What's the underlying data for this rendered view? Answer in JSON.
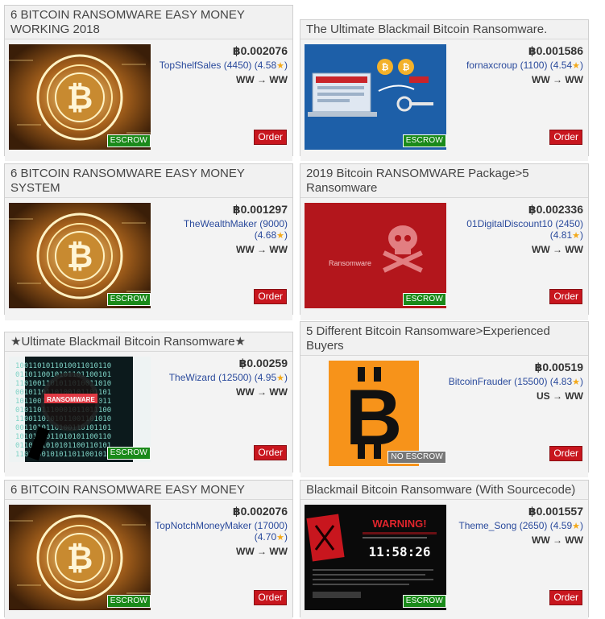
{
  "listings": [
    {
      "title": "6 BITCOIN RANSOMWARE EASY MONEY WORKING 2018",
      "price": "฿0.002076",
      "seller": "TopShelfSales (4450) (4.58",
      "star": "★",
      "seller_end": ")",
      "ship": "WW → WW",
      "badge": "ESCROW",
      "order": "Order",
      "image": "bitcoin-gold-coin"
    },
    {
      "title": "The Ultimate Blackmail Bitcoin Ransomware.",
      "price": "฿0.001586",
      "seller": "fornaxcroup (1100) (4.54",
      "star": "★",
      "seller_end": ")",
      "ship": "WW → WW",
      "badge": "ESCROW",
      "order": "Order",
      "image": "laptop-ransomware"
    },
    {
      "title": "6 BITCOIN RANSOMWARE EASY MONEY SYSTEM",
      "price": "฿0.001297",
      "seller": "TheWealthMaker (9000) (4.68",
      "star": "★",
      "seller_end": ")",
      "ship": "WW → WW",
      "badge": "ESCROW",
      "order": "Order",
      "image": "bitcoin-gold-coin"
    },
    {
      "title": "2019 Bitcoin RANSOMWARE Package>5 Ransomware",
      "price": "฿0.002336",
      "seller": "01DigitalDiscount10 (2450) (4.81",
      "star": "★",
      "seller_end": ")",
      "ship": "WW → WW",
      "badge": "ESCROW",
      "order": "Order",
      "image": "skull-ransomware",
      "img_text": "Ransomware"
    },
    {
      "title": "★Ultimate Blackmail Bitcoin Ransomware★",
      "price": "฿0.00259",
      "seller": "TheWizard (12500) (4.95",
      "star": "★",
      "seller_end": ")",
      "ship": "WW → WW",
      "badge": "ESCROW",
      "order": "Order",
      "image": "binary-magnifier",
      "img_text": "RANSOMWARE"
    },
    {
      "title": "5 Different Bitcoin Ransomware>Experienced Buyers",
      "price": "฿0.00519",
      "seller": "BitcoinFrauder (15500) (4.83",
      "star": "★",
      "seller_end": ")",
      "ship": "US → WW",
      "badge": "NO ESCROW",
      "order": "Order",
      "image": "bitcoin-orange-logo"
    },
    {
      "title": "6 BITCOIN RANSOMWARE EASY MONEY",
      "price": "฿0.002076",
      "seller": "TopNotchMoneyMaker (17000) (4.70",
      "star": "★",
      "seller_end": ")",
      "ship": "WW → WW",
      "badge": "ESCROW",
      "order": "Order",
      "image": "bitcoin-gold-coin"
    },
    {
      "title": "Blackmail Bitcoin Ransomware (With Sourcecode)",
      "price": "฿0.001557",
      "seller": "Theme_Song (2650) (4.59",
      "star": "★",
      "seller_end": ")",
      "ship": "WW → WW",
      "badge": "ESCROW",
      "order": "Order",
      "image": "warning-countdown",
      "img_text": "WARNING!",
      "img_timer": "11:58:26"
    }
  ],
  "colors": {
    "escrow": "#1a8a1a",
    "no_escrow": "#777777",
    "order": "#c8161e",
    "seller_link": "#2a4a9c",
    "star": "#f3a91a"
  }
}
